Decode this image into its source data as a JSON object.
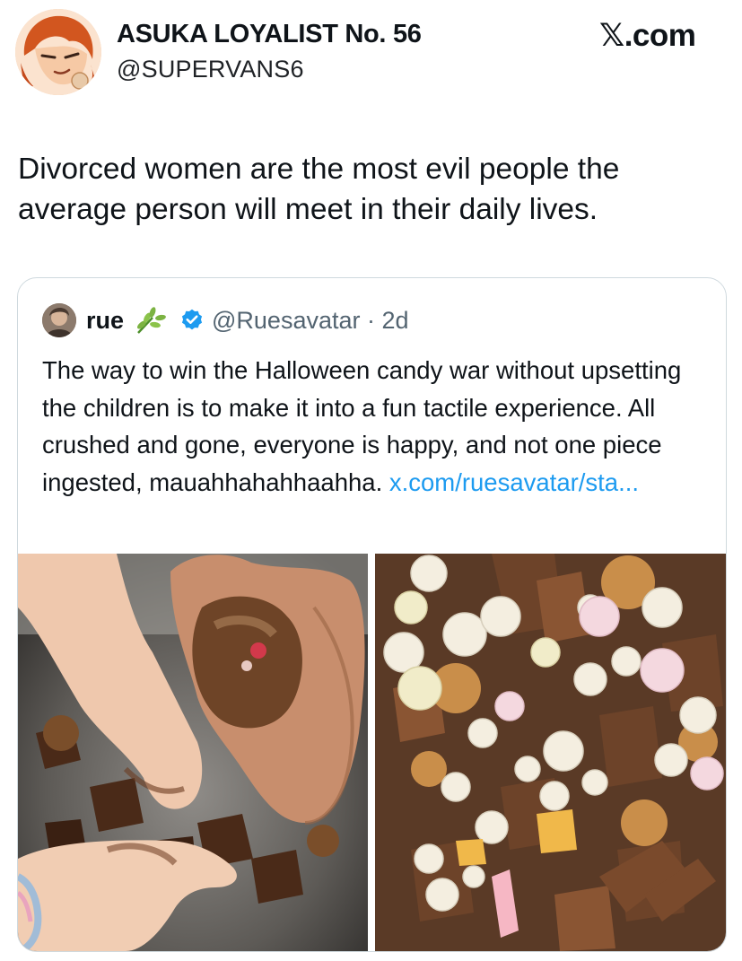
{
  "post": {
    "author": {
      "display_name": "ASUKA LOYALIST No. 56",
      "handle": "@SUPERVANS6",
      "avatar_icon": "anime-avatar-icon"
    },
    "watermark": "𝕏.com",
    "text": "Divorced women are the most evil people the average person will meet in their daily lives."
  },
  "quoted_post": {
    "author": {
      "display_name": "rue",
      "name_emoji_icon": "herb-icon",
      "verified_icon": "verified-badge-icon",
      "handle": "@Ruesavatar",
      "separator": " · ",
      "time": "2d"
    },
    "text": "The way to win the Halloween candy war without upsetting the children is to make it into a fun tactile experience. All crushed and gone, everyone is happy, and not one piece ingested, mauahhahahhaahha. ",
    "link_text": "x.com/ruesavatar/sta...",
    "link_color": "#1d9bf0",
    "media": [
      {
        "name": "hands-crushing-candy-photo"
      },
      {
        "name": "crushed-candy-pile-photo"
      }
    ]
  }
}
